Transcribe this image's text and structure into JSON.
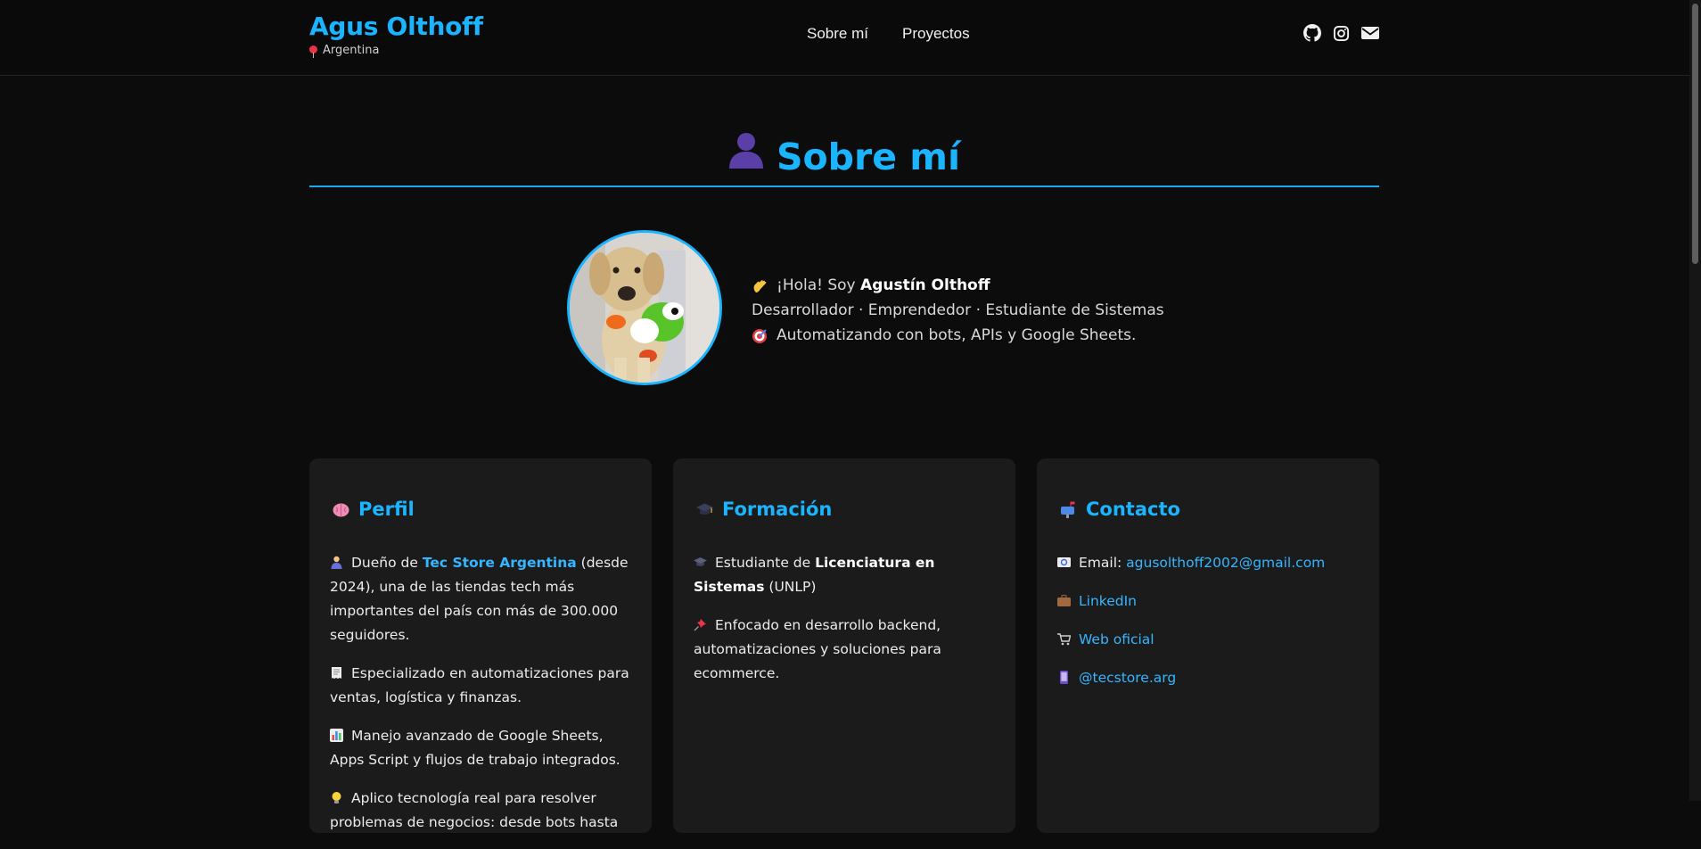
{
  "header": {
    "brand_name": "Agus Olthoff",
    "location": "Argentina",
    "nav": [
      "Sobre mí",
      "Proyectos"
    ],
    "social_icons": [
      "github-icon",
      "instagram-icon",
      "envelope-icon"
    ]
  },
  "section": {
    "title": "Sobre mí"
  },
  "intro": {
    "greeting": "¡Hola! Soy ",
    "name": "Agustín Olthoff",
    "roles": "Desarrollador · Emprendedor · Estudiante de Sistemas",
    "tagline": "Automatizando con bots, APIs y Google Sheets."
  },
  "cards": {
    "perfil": {
      "title": "Perfil",
      "p1_pre": "Dueño de ",
      "p1_link": "Tec Store Argentina",
      "p1_post": " (desde 2024), una de las tiendas tech más importantes del país con más de 300.000 seguidores.",
      "p2": "Especializado en automatizaciones para ventas, logística y finanzas.",
      "p3": "Manejo avanzado de Google Sheets, Apps Script y flujos de trabajo integrados.",
      "p4": "Aplico tecnología real para resolver problemas de negocios: desde bots hasta"
    },
    "formacion": {
      "title": "Formación",
      "p1_pre": "Estudiante de ",
      "p1_bold": "Licenciatura en Sistemas",
      "p1_post": " (UNLP)",
      "p2": "Enfocado en desarrollo backend, automatizaciones y soluciones para ecommerce."
    },
    "contacto": {
      "title": "Contacto",
      "email_label": "Email: ",
      "email": "agusolthoff2002@gmail.com",
      "linkedin": "LinkedIn",
      "web": "Web oficial",
      "instagram": "@tecstore.arg"
    }
  },
  "colors": {
    "accent": "#1ab4ff",
    "background": "#0c0c0c",
    "card": "#1b1b1b"
  }
}
